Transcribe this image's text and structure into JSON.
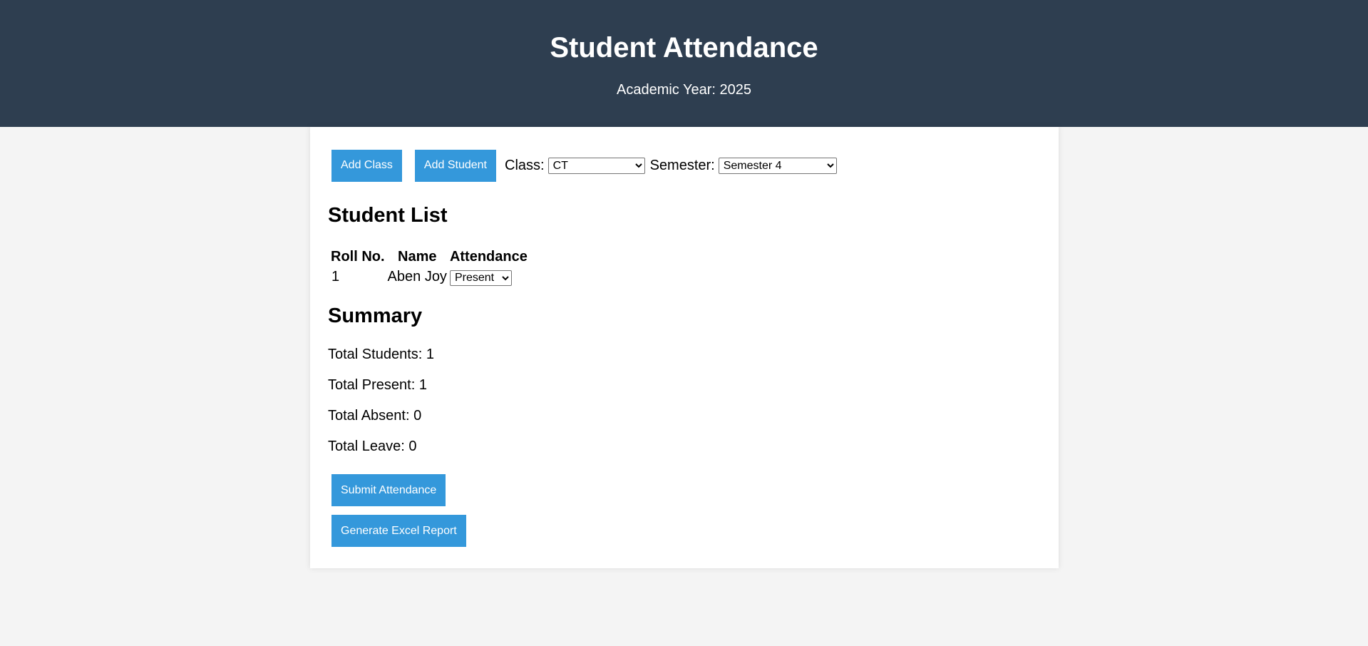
{
  "header": {
    "title": "Student Attendance",
    "subtitle": "Academic Year: 2025"
  },
  "toolbar": {
    "add_class_label": "Add Class",
    "add_student_label": "Add Student",
    "class_label": "Class:",
    "class_selected": "CT",
    "semester_label": "Semester:",
    "semester_selected": "Semester 4"
  },
  "student_list": {
    "title": "Student List",
    "columns": [
      "Roll No.",
      "Name",
      "Attendance"
    ],
    "rows": [
      {
        "roll": "1",
        "name": "Aben Joy",
        "attendance": "Present"
      }
    ]
  },
  "summary": {
    "title": "Summary",
    "total_students": "Total Students: 1",
    "total_present": "Total Present: 1",
    "total_absent": "Total Absent: 0",
    "total_leave": "Total Leave: 0"
  },
  "actions": {
    "submit_label": "Submit Attendance",
    "excel_label": "Generate Excel Report"
  },
  "colors": {
    "header_bg": "#2e3e50",
    "button_bg": "#3498db",
    "page_bg": "#f4f4f4"
  }
}
